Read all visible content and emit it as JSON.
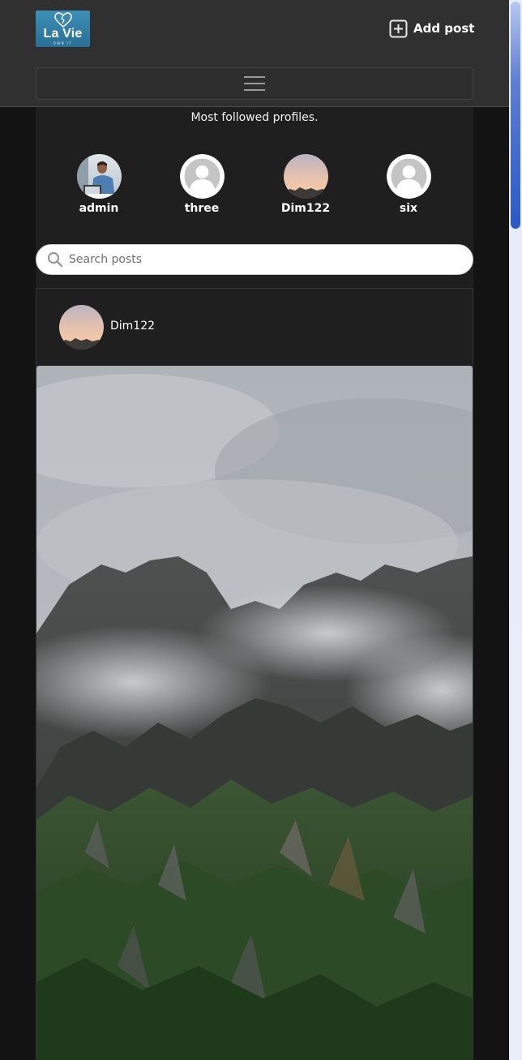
{
  "header": {
    "logo_text": "La Vie",
    "logo_tagline": "OWN IT",
    "add_post_label": "Add post"
  },
  "followed": {
    "title": "Most followed profiles.",
    "profiles": [
      {
        "name": "admin",
        "avatar": "photo-man-laptop"
      },
      {
        "name": "three",
        "avatar": "default-user-icon"
      },
      {
        "name": "Dim122",
        "avatar": "photo-sunset-sky"
      },
      {
        "name": "six",
        "avatar": "default-user-icon"
      }
    ]
  },
  "search": {
    "placeholder": "Search posts",
    "value": ""
  },
  "posts": [
    {
      "author": "Dim122",
      "avatar": "photo-sunset-sky",
      "image": "misty-green-mountains"
    }
  ],
  "colors": {
    "page_bg": "#131313",
    "navbar_bg": "#303030",
    "card_bg": "#1f1f1f",
    "logo_blue": "#3182ad",
    "scroll_thumb": "#2a58c6"
  }
}
